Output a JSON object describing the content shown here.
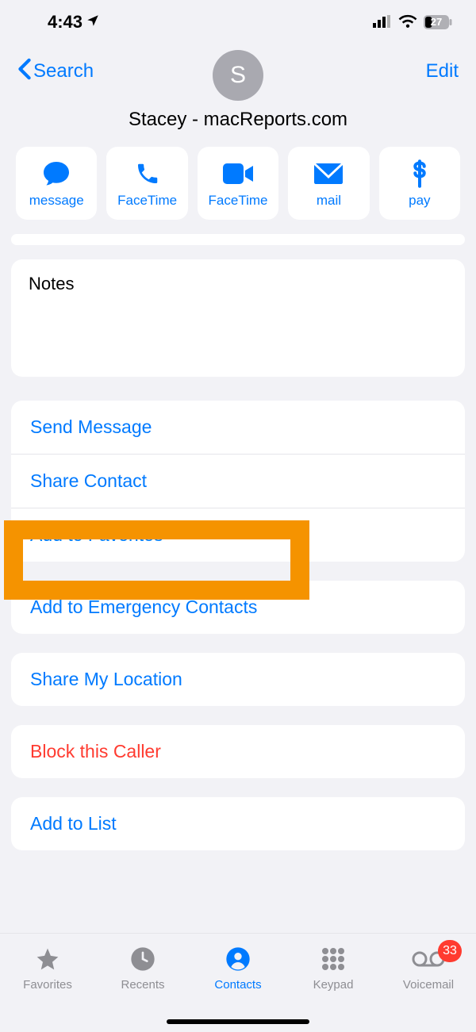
{
  "status": {
    "time": "4:43",
    "battery": "27"
  },
  "nav": {
    "back": "Search",
    "edit": "Edit"
  },
  "contact": {
    "initial": "S",
    "name": "Stacey - macReports.com"
  },
  "actions": {
    "message": "message",
    "facetime_audio": "FaceTime",
    "facetime_video": "FaceTime",
    "mail": "mail",
    "pay": "pay"
  },
  "notes": {
    "label": "Notes"
  },
  "options": {
    "send_message": "Send Message",
    "share_contact": "Share Contact",
    "add_favorites": "Add to Favorites",
    "add_emergency": "Add to Emergency Contacts",
    "share_location": "Share My Location",
    "block": "Block this Caller",
    "add_list": "Add to List"
  },
  "tabs": {
    "favorites": "Favorites",
    "recents": "Recents",
    "contacts": "Contacts",
    "keypad": "Keypad",
    "voicemail": "Voicemail",
    "voicemail_badge": "33"
  }
}
